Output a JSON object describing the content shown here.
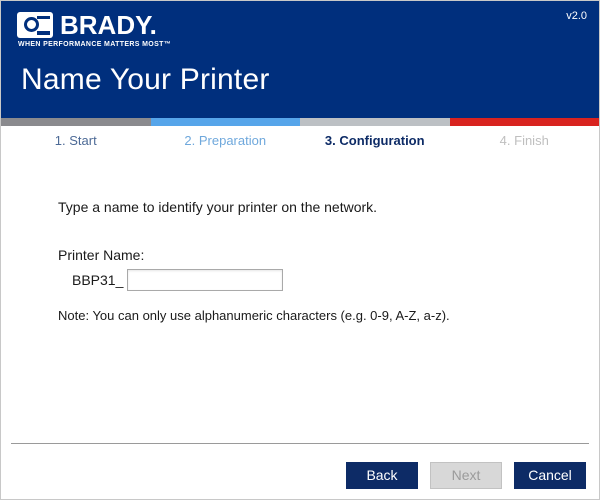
{
  "window": {
    "border_color": "#c8c8c8"
  },
  "header": {
    "background": "#002f7d",
    "brand": {
      "wordmark": "BRADY.",
      "tagline": "WHEN PERFORMANCE MATTERS MOST™",
      "logo_icon": "brady-logo-icon"
    },
    "version": "v2.0",
    "title": "Name Your Printer"
  },
  "stepbar": {
    "segments": [
      {
        "name": "start",
        "color": "#8a8a8e"
      },
      {
        "name": "preparation",
        "color": "#56a5ea"
      },
      {
        "name": "configuration",
        "color": "#bcc0c4"
      },
      {
        "name": "finish",
        "color": "#d8231f"
      }
    ]
  },
  "steps": [
    {
      "label": "1. Start",
      "state": "done",
      "color": "#4d6a96"
    },
    {
      "label": "2. Preparation",
      "state": "previous",
      "color": "#6fa8dc"
    },
    {
      "label": "3. Configuration",
      "state": "active",
      "color": "#0d2b66"
    },
    {
      "label": "4. Finish",
      "state": "todo",
      "color": "#bfbfbf"
    }
  ],
  "content": {
    "instruction": "Type a name to identify your printer on the network.",
    "field_label": "Printer Name:",
    "name_prefix": "BBP31_",
    "printer_name_value": "",
    "printer_name_placeholder": "",
    "note": "Note: You can only use alphanumeric characters (e.g. 0-9, A-Z, a-z)."
  },
  "footer": {
    "buttons": [
      {
        "label": "Back",
        "style": "primary",
        "enabled": true
      },
      {
        "label": "Next",
        "style": "disabled",
        "enabled": false
      },
      {
        "label": "Cancel",
        "style": "primary",
        "enabled": true
      }
    ]
  }
}
